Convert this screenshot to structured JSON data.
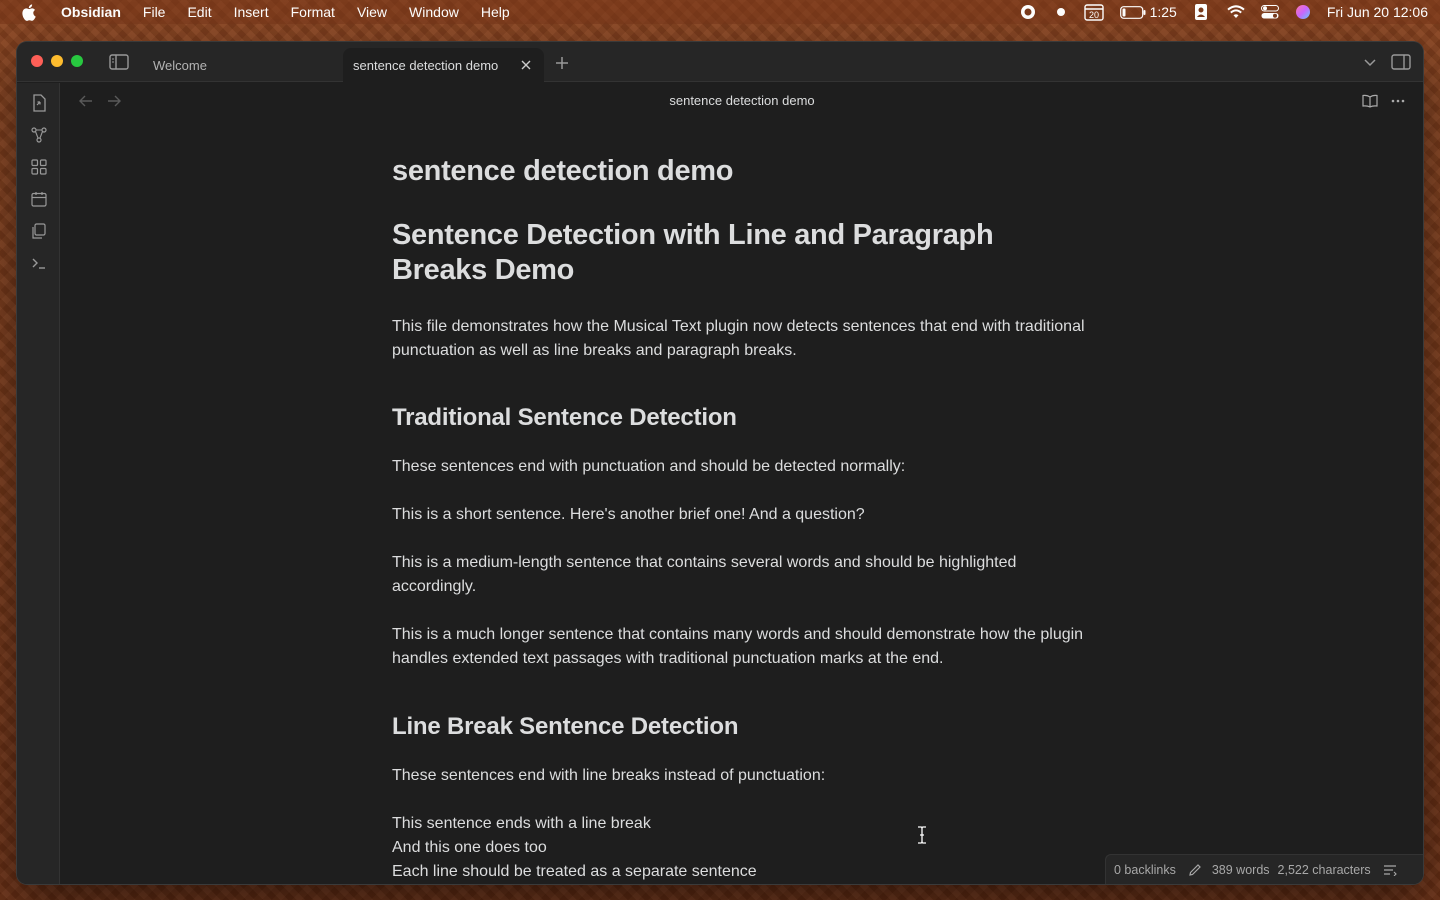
{
  "menubar": {
    "app_name": "Obsidian",
    "items": [
      "File",
      "Edit",
      "Insert",
      "Format",
      "View",
      "Window",
      "Help"
    ],
    "calendar_day": "20",
    "battery_time": "1:25",
    "datetime": "Fri Jun 20  12:06"
  },
  "tabs": {
    "welcome_label": "Welcome",
    "active_label": "sentence detection demo"
  },
  "view_header": {
    "title": "sentence detection demo"
  },
  "document": {
    "title": "sentence detection demo",
    "h1": "Sentence Detection with Line and Paragraph Breaks Demo",
    "intro": "This file demonstrates how the Musical Text plugin now detects sentences that end with traditional punctuation as well as line breaks and paragraph breaks.",
    "section1_heading": "Traditional Sentence Detection",
    "section1_p1": "These sentences end with punctuation and should be detected normally:",
    "section1_p2": "This is a short sentence. Here's another brief one! And a question?",
    "section1_p3": "This is a medium-length sentence that contains several words and should be highlighted accordingly.",
    "section1_p4": "This is a much longer sentence that contains many words and should demonstrate how the plugin handles extended text passages with traditional punctuation marks at the end.",
    "section2_heading": "Line Break Sentence Detection",
    "section2_p1": "These sentences end with line breaks instead of punctuation:",
    "section2_line1": "This sentence ends with a line break",
    "section2_line2": "And this one does too",
    "section2_line3": "Each line should be treated as a separate sentence"
  },
  "status_bar": {
    "backlinks": "0 backlinks",
    "words": "389 words",
    "characters": "2,522 characters"
  },
  "icons": {
    "apple": "apple-icon",
    "record": "screen-record-icon",
    "dot": "status-dot-icon",
    "calendar": "calendar-icon",
    "battery": "battery-icon",
    "user": "user-icon",
    "wifi": "wifi-icon",
    "control_center": "control-center-icon",
    "siri": "siri-icon"
  }
}
